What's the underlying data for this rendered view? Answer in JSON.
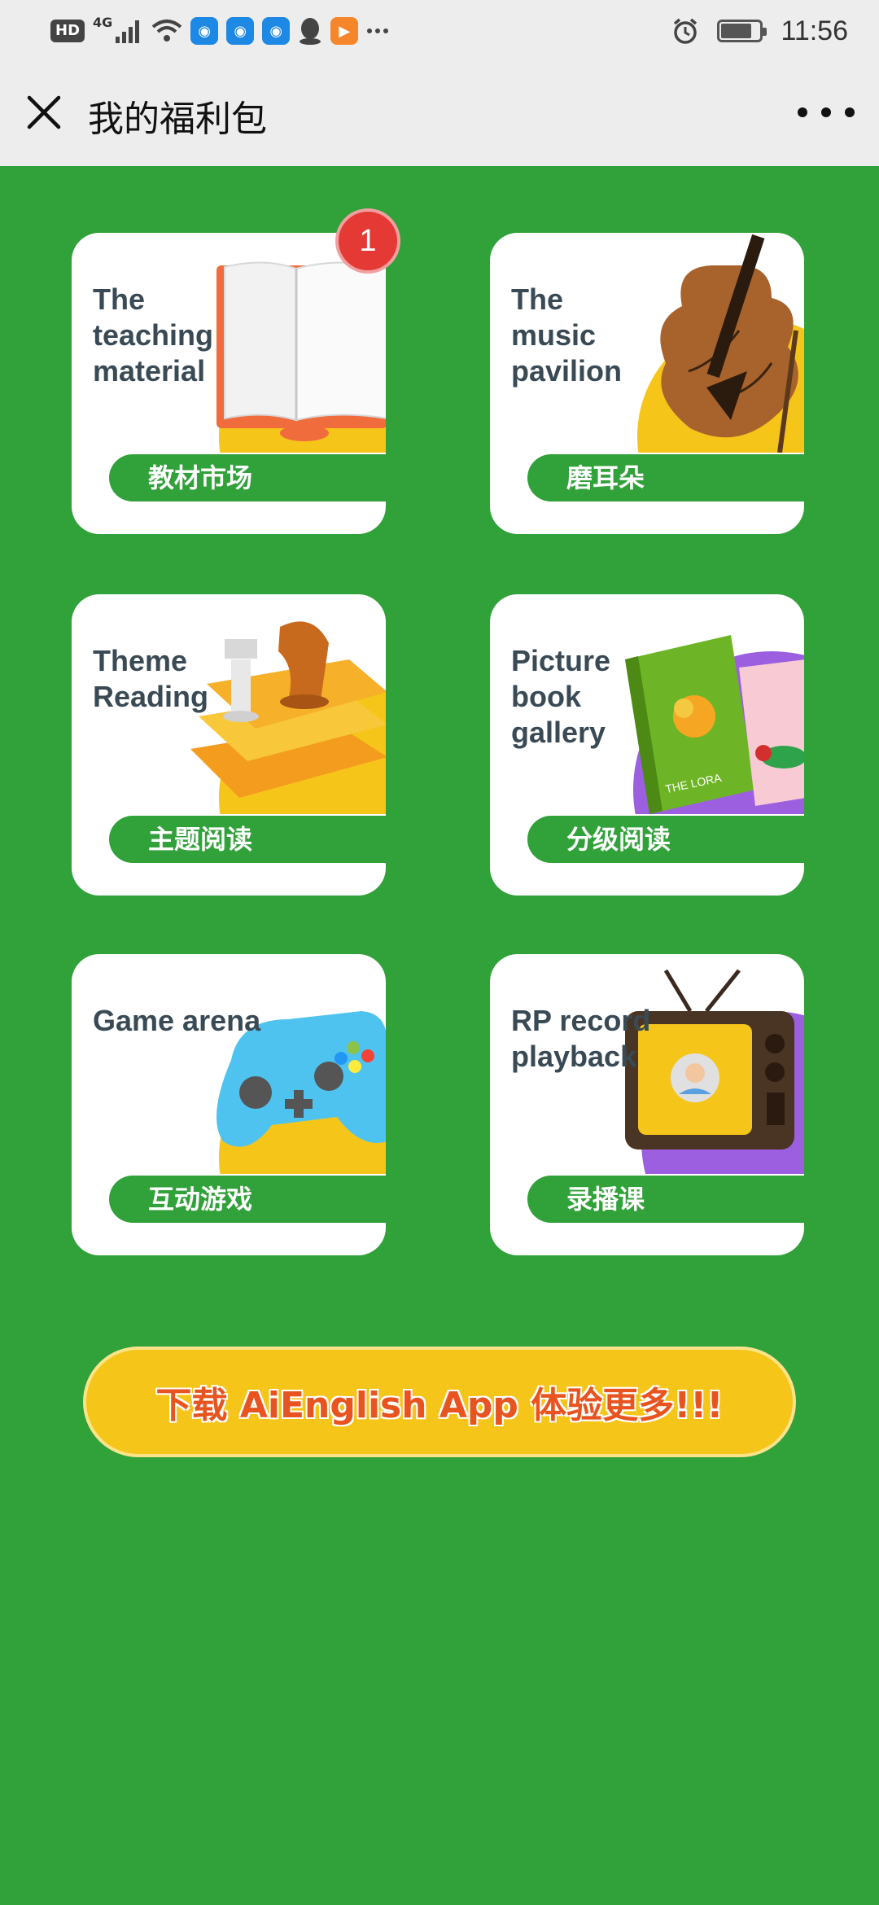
{
  "status_bar": {
    "hd": "HD",
    "network": "4G",
    "time": "11:56",
    "battery_level": 0.8
  },
  "nav": {
    "title": "我的福利包"
  },
  "cards": [
    {
      "en": "The\nteaching\nmaterial",
      "cn": "教材市场",
      "badge": "1"
    },
    {
      "en": "The\nmusic\npavilion",
      "cn": "磨耳朵"
    },
    {
      "en": "Theme\nReading",
      "cn": "主题阅读"
    },
    {
      "en": "Picture\nbook\ngallery",
      "cn": "分级阅读",
      "book_label": "THE LORA"
    },
    {
      "en": "Game arena",
      "cn": "互动游戏"
    },
    {
      "en": "RP record\nplayback",
      "cn": "录播课"
    }
  ],
  "cta": {
    "label": "下载 AiEnglish App 体验更多!!!"
  },
  "colors": {
    "background": "#31a13a",
    "accent_yellow": "#f6c51a",
    "cta_text": "#e8541f",
    "badge": "#e53935"
  }
}
